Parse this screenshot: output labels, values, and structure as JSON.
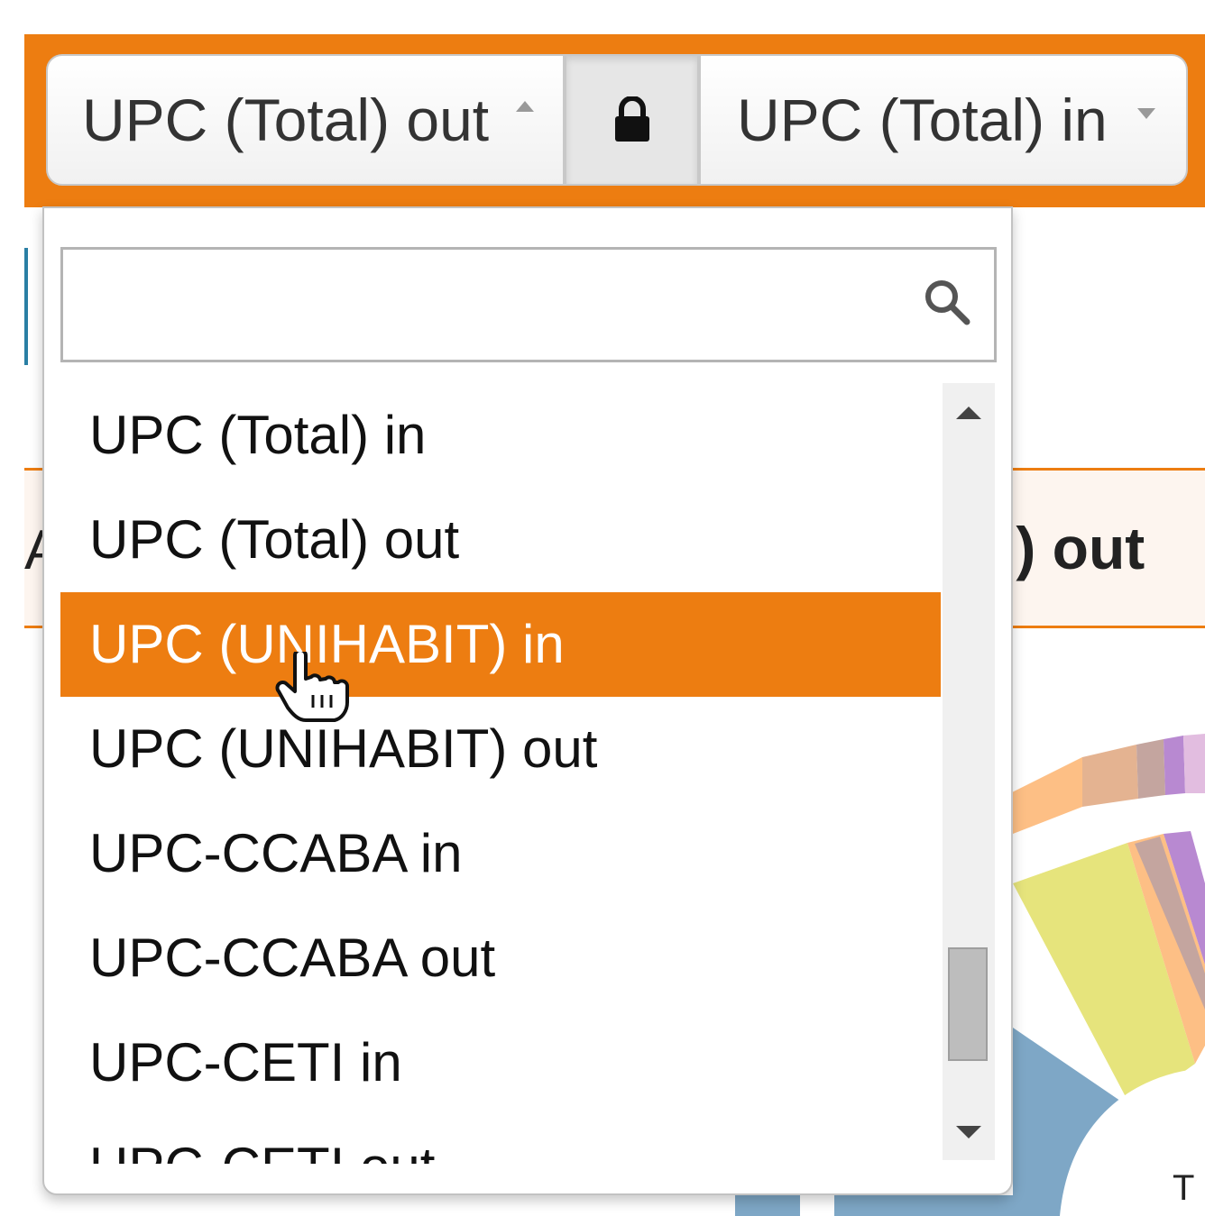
{
  "toolbar": {
    "left_select": {
      "value": "UPC (Total) out",
      "state": "expanded",
      "caret": "caret-up-icon"
    },
    "lock": {
      "icon": "lock-icon"
    },
    "right_select": {
      "value": "UPC (Total) in",
      "caret": "caret-down-icon"
    }
  },
  "dropdown": {
    "search": {
      "value": "",
      "placeholder": "",
      "icon": "search-icon"
    },
    "options": [
      {
        "label": "UPC (Total) in"
      },
      {
        "label": "UPC (Total) out"
      },
      {
        "label": "UPC (UNIHABIT) in",
        "highlighted": true
      },
      {
        "label": "UPC (UNIHABIT) out"
      },
      {
        "label": "UPC-CCABA in"
      },
      {
        "label": "UPC-CCABA out"
      },
      {
        "label": "UPC-CETI in"
      },
      {
        "label": "UPC-CETI out"
      }
    ]
  },
  "background": {
    "band_left_text": "A",
    "band_right_text": "l) out",
    "chart_label": "T"
  },
  "colors": {
    "accent": "#ed7d11",
    "highlight_text": "#ffffff",
    "chart_blue": "#7ea7c6",
    "chart_peach": "#fdbf85",
    "chart_yellow": "#e6e47c",
    "chart_purple": "#b889d1",
    "chart_taupe": "#c4a59f"
  }
}
